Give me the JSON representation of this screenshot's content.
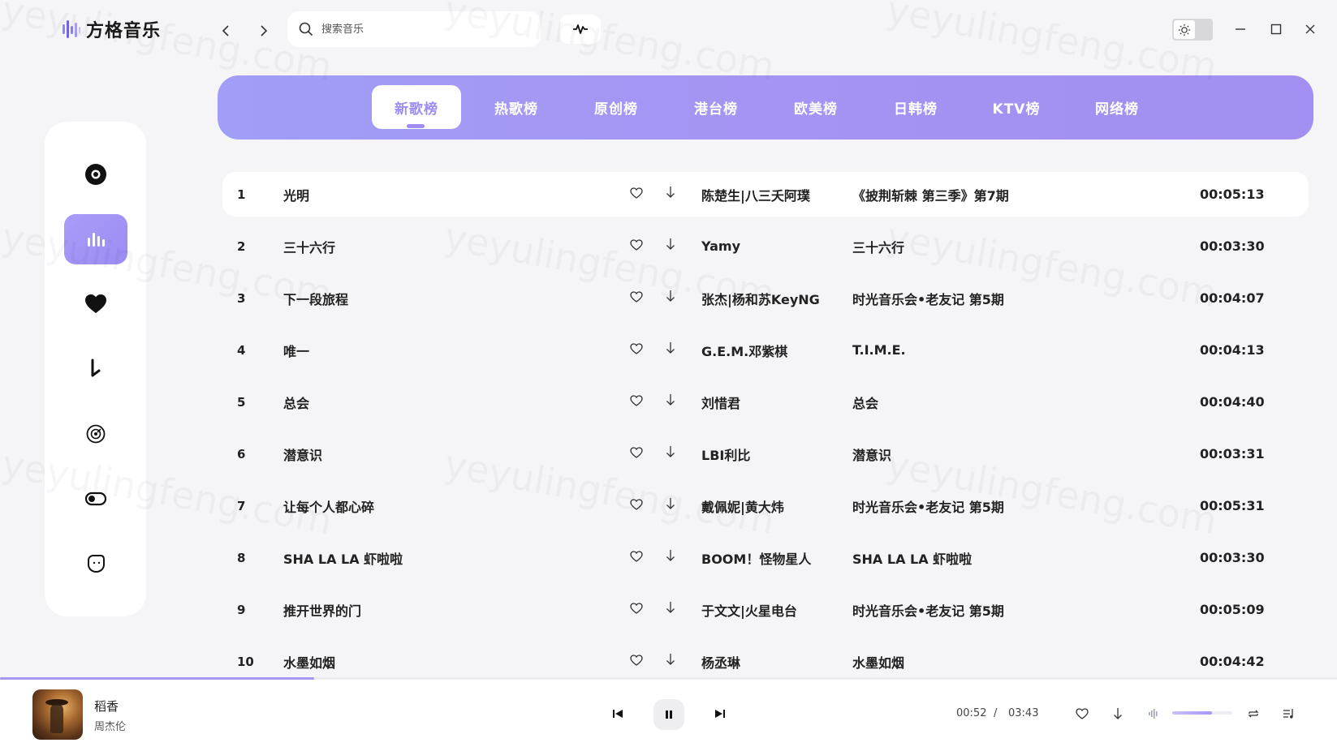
{
  "app": {
    "name": "方格音乐",
    "accent_color": "#9f8cf2"
  },
  "search": {
    "placeholder": "搜索音乐",
    "value": ""
  },
  "tabs": [
    {
      "label": "新歌榜",
      "active": true
    },
    {
      "label": "热歌榜",
      "active": false
    },
    {
      "label": "原创榜",
      "active": false
    },
    {
      "label": "港台榜",
      "active": false
    },
    {
      "label": "欧美榜",
      "active": false
    },
    {
      "label": "日韩榜",
      "active": false
    },
    {
      "label": "KTV榜",
      "active": false
    },
    {
      "label": "网络榜",
      "active": false
    }
  ],
  "sidebar": {
    "items": [
      {
        "icon": "disc-icon",
        "active": false
      },
      {
        "icon": "chart-bars-icon",
        "active": true
      },
      {
        "icon": "heart-icon",
        "active": false
      },
      {
        "icon": "download-icon",
        "active": false
      },
      {
        "icon": "cd-icon",
        "active": false
      },
      {
        "icon": "toggle-icon",
        "active": false
      },
      {
        "icon": "face-icon",
        "active": false
      }
    ]
  },
  "songs": [
    {
      "num": "1",
      "title": "光明",
      "artist": "陈楚生|八三夭阿璞",
      "album": "《披荆斩棘 第三季》第7期",
      "duration": "00:05:13"
    },
    {
      "num": "2",
      "title": "三十六行",
      "artist": "Yamy",
      "album": "三十六行",
      "duration": "00:03:30"
    },
    {
      "num": "3",
      "title": "下一段旅程",
      "artist": "张杰|杨和苏KeyNG",
      "album": "时光音乐会•老友记 第5期",
      "duration": "00:04:07"
    },
    {
      "num": "4",
      "title": "唯一",
      "artist": "G.E.M.邓紫棋",
      "album": "T.I.M.E.",
      "duration": "00:04:13"
    },
    {
      "num": "5",
      "title": "总会",
      "artist": "刘惜君",
      "album": "总会",
      "duration": "00:04:40"
    },
    {
      "num": "6",
      "title": "潜意识",
      "artist": "LBI利比",
      "album": "潜意识",
      "duration": "00:03:31"
    },
    {
      "num": "7",
      "title": "让每个人都心碎",
      "artist": "戴佩妮|黄大炜",
      "album": "时光音乐会•老友记 第5期",
      "duration": "00:05:31"
    },
    {
      "num": "8",
      "title": "SHA LA LA 虾啦啦",
      "artist": "BOOM！怪物星人",
      "album": "SHA LA LA 虾啦啦",
      "duration": "00:03:30"
    },
    {
      "num": "9",
      "title": "推开世界的门",
      "artist": "于文文|火星电台",
      "album": "时光音乐会•老友记 第5期",
      "duration": "00:05:09"
    },
    {
      "num": "10",
      "title": "水墨如烟",
      "artist": "杨丞琳",
      "album": "水墨如烟",
      "duration": "00:04:42"
    }
  ],
  "player": {
    "song": "稻香",
    "artist": "周杰伦",
    "current_time": "00:52",
    "separator": "/",
    "total_time": "03:43",
    "list_progress_fraction": 0.235,
    "volume_fraction": 0.66
  },
  "watermark": "yeyulingfeng.com"
}
